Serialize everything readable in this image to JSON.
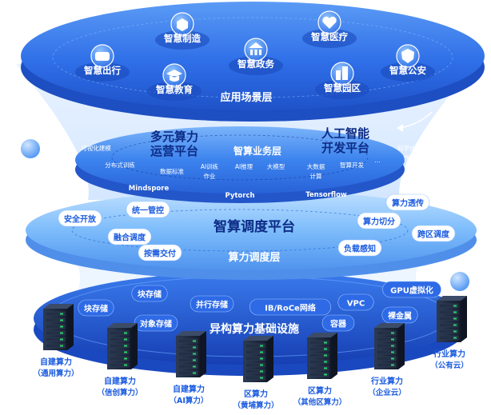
{
  "colors": {
    "layer_top": "#2f73ec",
    "layer_mid": "#3f86f2",
    "layer_sched": "#6ab0fa",
    "layer_infra": "#1e58d4",
    "pill_bg": "#ffffff",
    "pill_text": "#1a5be0",
    "label_text": "#ffffff",
    "dark_text": "#0d2c86",
    "server_dark": "#1a2436",
    "server_green": "#2fd46a"
  },
  "app_layer": {
    "label": "应用场景层",
    "bubbles": [
      {
        "label": "智慧制造",
        "icon": "cube-icon"
      },
      {
        "label": "智慧医疗",
        "icon": "heart-pulse-icon"
      },
      {
        "label": "智慧出行",
        "icon": "car-icon"
      },
      {
        "label": "智慧政务",
        "icon": "government-icon"
      },
      {
        "label": "智慧公安",
        "icon": "police-badge-icon"
      },
      {
        "label": "智慧教育",
        "icon": "graduation-cap-icon"
      },
      {
        "label": "智慧园区",
        "icon": "buildings-icon"
      }
    ]
  },
  "business_layer": {
    "label": "智算业务层",
    "left_title_line1": "多元算力",
    "left_title_line2": "运营平台",
    "right_title_line1": "人工智能",
    "right_title_line2": "开发平台",
    "items": [
      "可视化建模",
      "分布式训练",
      "数据标准",
      "AI训练",
      "作业",
      "AI推理",
      "大模型",
      "大数据",
      "计算",
      "智算开发",
      "...",
      "科学计算",
      "作业"
    ],
    "frameworks": [
      "Mindspore",
      "Pytorch",
      "Tensorflow"
    ]
  },
  "scheduling_layer": {
    "label": "算力调度层",
    "platform": "智算调度平台",
    "pills": [
      "统一管控",
      "安全开放",
      "融合调度",
      "按需交付",
      "算力透传",
      "算力切分",
      "跨区调度",
      "负载感知"
    ]
  },
  "infra_layer": {
    "label": "异构算力基础设施",
    "pills": [
      "块存储",
      "块存储",
      "并行存储",
      "对象存储",
      "IB/RoCe网络",
      "VPC",
      "GPU虚拟化",
      "容器",
      "裸金属"
    ]
  },
  "servers": [
    {
      "line1": "自建算力",
      "line2": "（通用算力）"
    },
    {
      "line1": "自建算力",
      "line2": "（信创算力）"
    },
    {
      "line1": "自建算力",
      "line2": "（AI算力）"
    },
    {
      "line1": "区算力",
      "line2": "（黄埔算力）"
    },
    {
      "line1": "区算力",
      "line2": "（其他区算力）"
    },
    {
      "line1": "行业算力",
      "line2": "（企业云）"
    },
    {
      "line1": "行业算力",
      "line2": "（公有云）"
    }
  ]
}
